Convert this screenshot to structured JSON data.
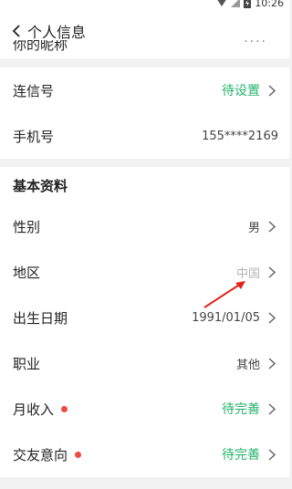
{
  "status_bar": {
    "time": "10:26"
  },
  "header": {
    "title": "个人信息"
  },
  "cut_row": {
    "label": "你的昵称",
    "value": "····"
  },
  "account_section": {
    "rows": [
      {
        "label": "连信号",
        "value": "待设置"
      },
      {
        "label": "手机号",
        "value": "155****2169"
      }
    ]
  },
  "basic_section": {
    "title": "基本资料",
    "rows": [
      {
        "label": "性别",
        "value": "男"
      },
      {
        "label": "地区",
        "value": "中国"
      },
      {
        "label": "出生日期",
        "value": "1991/01/05"
      },
      {
        "label": "职业",
        "value": "其他"
      },
      {
        "label": "月收入",
        "value": "待完善"
      },
      {
        "label": "交友意向",
        "value": "待完善"
      }
    ]
  },
  "colors": {
    "accent_green": "#24b36b",
    "alert_red": "#ef4a43",
    "annotation_red": "#e0231b"
  }
}
